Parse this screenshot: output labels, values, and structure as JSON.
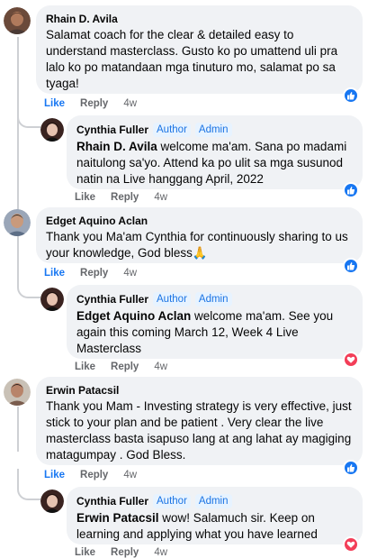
{
  "comments": [
    {
      "author": "Rhain D. Avila",
      "text": "Salamat coach for the clear & detailed easy to understand masterclass. Gusto ko po umattend uli pra lalo ko po matandaan mga tinuturo mo, salamat po sa tyaga!",
      "actions": {
        "like": "Like",
        "reply": "Reply",
        "time": "4w"
      },
      "reaction": "like-icon",
      "reply": {
        "author": "Cynthia Fuller",
        "badges": [
          "Author",
          "Admin"
        ],
        "mention": "Rhain D. Avila",
        "text": " welcome ma'am. Sana po madami naitulong sa'yo. Attend ka po ulit sa mga susunod natin na Live hanggang April, 2022",
        "actions": {
          "like": "Like",
          "reply": "Reply",
          "time": "4w"
        },
        "reaction": "like-icon"
      }
    },
    {
      "author": "Edget Aquino Aclan",
      "text": "Thank you Ma'am Cynthia for continuously sharing to us your knowledge, God bless🙏",
      "actions": {
        "like": "Like",
        "reply": "Reply",
        "time": "4w"
      },
      "reaction": "like-icon",
      "reply": {
        "author": "Cynthia Fuller",
        "badges": [
          "Author",
          "Admin"
        ],
        "mention": "Edget Aquino Aclan",
        "text": " welcome ma'am. See you again this coming March 12, Week 4 Live Masterclass",
        "actions": {
          "like": "Like",
          "reply": "Reply",
          "time": "4w"
        },
        "reaction": "love-icon"
      }
    },
    {
      "author": "Erwin Patacsil",
      "text": "Thank you Mam - Investing strategy is very effective, just stick to your plan and be patient . Very clear the live masterclass basta isapuso lang at ang lahat ay magiging matagumpay . God Bless.",
      "actions": {
        "like": "Like",
        "reply": "Reply",
        "time": "4w"
      },
      "reaction": "like-icon",
      "reply": {
        "author": "Cynthia Fuller",
        "badges": [
          "Author",
          "Admin"
        ],
        "mention": "Erwin Patacsil",
        "text": " wow! Salamuch sir. Keep on learning and applying what you have learned",
        "actions": {
          "like": "Like",
          "reply": "Reply",
          "time": "4w"
        },
        "reaction": "love-icon"
      }
    }
  ],
  "colors": {
    "link": "#1877f2",
    "badge_text": "#1b74e4",
    "badge_bg": "#e7f3ff",
    "bubble_bg": "#f0f2f5",
    "meta": "#65676b",
    "love": "#f33e58"
  }
}
